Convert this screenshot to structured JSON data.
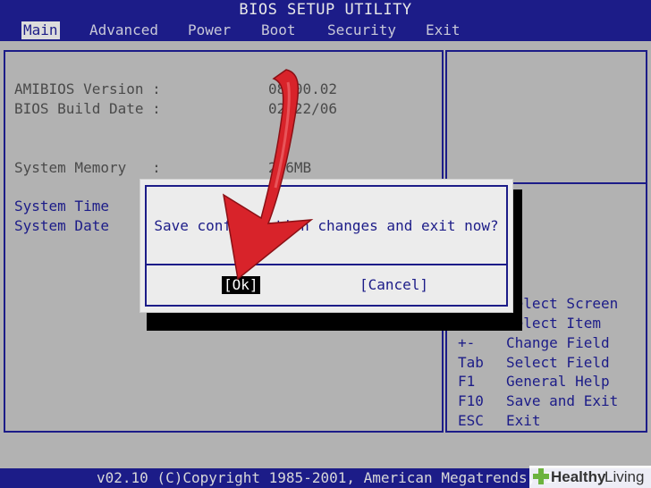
{
  "title": "BIOS SETUP UTILITY",
  "menu": [
    "Main",
    "Advanced",
    "Power",
    "Boot",
    "Security",
    "Exit"
  ],
  "menu_active": "Main",
  "info": [
    {
      "label": "AMIBIOS Version :",
      "value": "08.00.02"
    },
    {
      "label": "BIOS Build Date :",
      "value": "02/22/06"
    },
    {
      "label": "System Memory   :",
      "value": "256MB"
    }
  ],
  "fields": [
    "System Time",
    "System Date"
  ],
  "help": [
    {
      "key": "",
      "desc": "Select Screen"
    },
    {
      "key": "↑↓",
      "desc": "Select Item"
    },
    {
      "key": "+-",
      "desc": "Change Field"
    },
    {
      "key": "Tab",
      "desc": "Select Field"
    },
    {
      "key": "F1",
      "desc": "General Help"
    },
    {
      "key": "F10",
      "desc": "Save and Exit"
    },
    {
      "key": "ESC",
      "desc": "Exit"
    }
  ],
  "dialog": {
    "message": "Save configuration changes and exit now?",
    "ok": "[Ok]",
    "cancel": "[Cancel]"
  },
  "footer": "v02.10 (C)Copyright 1985-2001, American Megatrends, Inc.",
  "watermark": {
    "brand": "Healthy",
    "tag": "Living"
  },
  "colors": {
    "bios_blue": "#1c1c88",
    "bios_gray": "#b2b2b2",
    "arrow_red": "#d8232a",
    "watermark_green": "#6cb33f"
  }
}
